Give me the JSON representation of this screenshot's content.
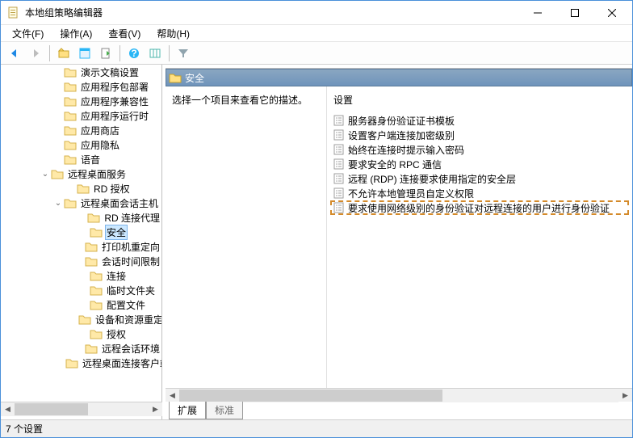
{
  "title": "本地组策略编辑器",
  "menus": {
    "file": "文件(F)",
    "action": "操作(A)",
    "view": "查看(V)",
    "help": "帮助(H)"
  },
  "tree": {
    "items": [
      {
        "indent": 4,
        "exp": "",
        "label": "演示文稿设置"
      },
      {
        "indent": 4,
        "exp": "",
        "label": "应用程序包部署"
      },
      {
        "indent": 4,
        "exp": "",
        "label": "应用程序兼容性"
      },
      {
        "indent": 4,
        "exp": "",
        "label": "应用程序运行时"
      },
      {
        "indent": 4,
        "exp": "",
        "label": "应用商店"
      },
      {
        "indent": 4,
        "exp": "",
        "label": "应用隐私"
      },
      {
        "indent": 4,
        "exp": "",
        "label": "语音"
      },
      {
        "indent": 3,
        "exp": "v",
        "label": "远程桌面服务"
      },
      {
        "indent": 5,
        "exp": "",
        "label": "RD 授权"
      },
      {
        "indent": 4,
        "exp": "v",
        "label": "远程桌面会话主机"
      },
      {
        "indent": 6,
        "exp": "",
        "label": "RD 连接代理"
      },
      {
        "indent": 6,
        "exp": "",
        "label": "安全",
        "selected": true
      },
      {
        "indent": 6,
        "exp": "",
        "label": "打印机重定向"
      },
      {
        "indent": 6,
        "exp": "",
        "label": "会话时间限制"
      },
      {
        "indent": 6,
        "exp": "",
        "label": "连接"
      },
      {
        "indent": 6,
        "exp": "",
        "label": "临时文件夹"
      },
      {
        "indent": 6,
        "exp": "",
        "label": "配置文件"
      },
      {
        "indent": 6,
        "exp": "",
        "label": "设备和资源重定向"
      },
      {
        "indent": 6,
        "exp": "",
        "label": "授权"
      },
      {
        "indent": 6,
        "exp": "",
        "label": "远程会话环境"
      },
      {
        "indent": 5,
        "exp": "",
        "label": "远程桌面连接客户端"
      }
    ]
  },
  "panel": {
    "title": "安全",
    "desc": "选择一个项目来查看它的描述。",
    "col": "设置",
    "settings": [
      "服务器身份验证证书模板",
      "设置客户端连接加密级别",
      "始终在连接时提示输入密码",
      "要求安全的 RPC 通信",
      "远程 (RDP) 连接要求使用指定的安全层",
      "不允许本地管理员自定义权限",
      "要求使用网络级别的身份验证对远程连接的用户进行身份验证"
    ],
    "highlightIndex": 6
  },
  "tabs": {
    "extended": "扩展",
    "standard": "标准"
  },
  "status": "7 个设置"
}
